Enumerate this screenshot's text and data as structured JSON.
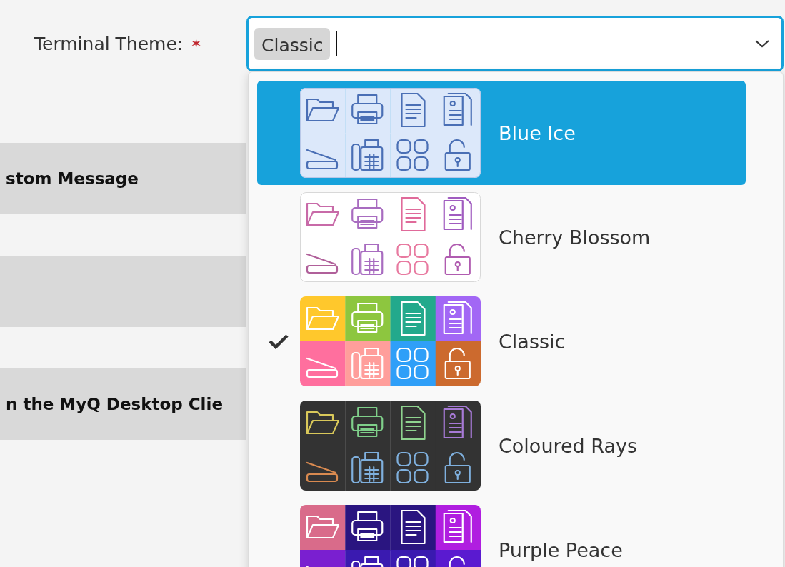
{
  "field": {
    "label": "Terminal Theme:",
    "required_mark": "✶",
    "value": "Classic",
    "expanded": true
  },
  "section_bars": [
    {
      "kind": "titled",
      "title": "stom Message"
    },
    {
      "kind": "blank"
    },
    {
      "kind": "titled",
      "title": "n the MyQ Desktop Clie"
    }
  ],
  "options": [
    {
      "label": "Blue Ice",
      "selected": true,
      "checked": false
    },
    {
      "label": "Cherry Blossom",
      "selected": false,
      "checked": false
    },
    {
      "label": "Classic",
      "selected": false,
      "checked": true
    },
    {
      "label": "Coloured Rays",
      "selected": false,
      "checked": false
    },
    {
      "label": "Purple Peace",
      "selected": false,
      "checked": false
    }
  ]
}
